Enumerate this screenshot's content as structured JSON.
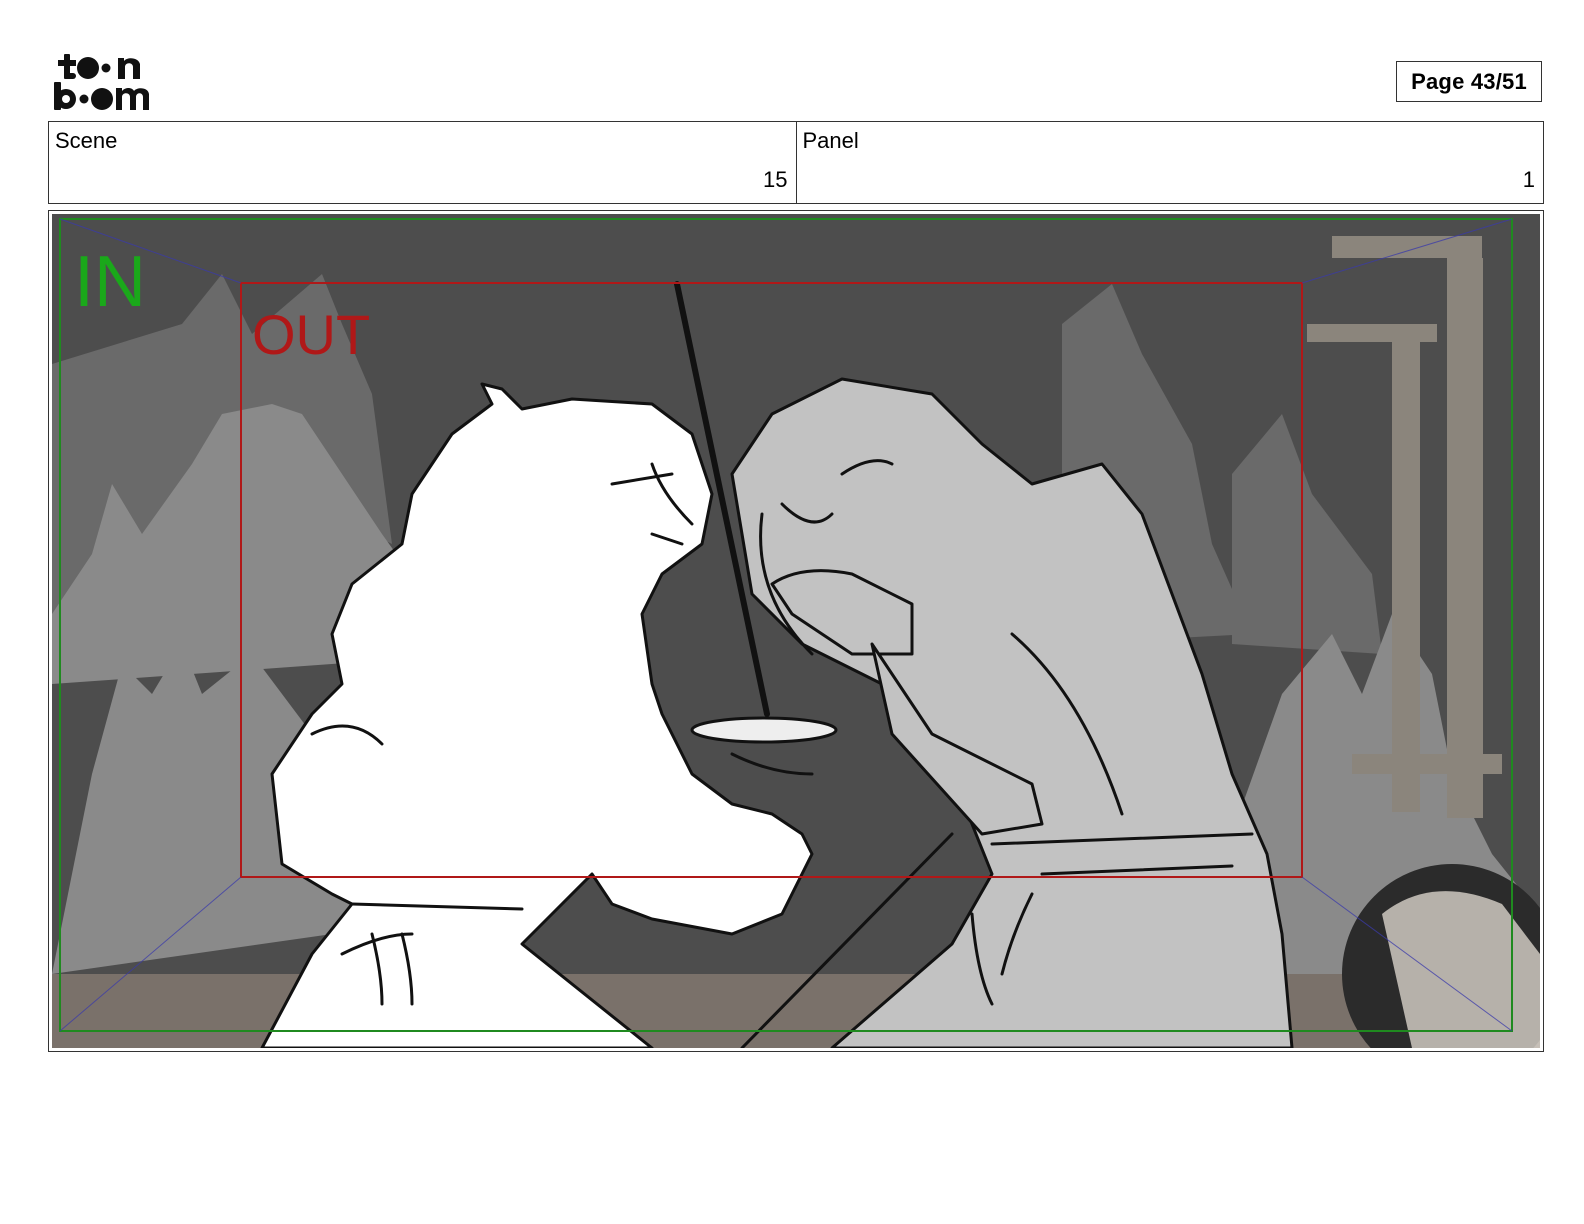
{
  "header": {
    "logo_line1": "toon",
    "logo_line2": "boom",
    "page_label": "Page 43/51"
  },
  "scene": {
    "label": "Scene",
    "value": "15"
  },
  "panel": {
    "label": "Panel",
    "value": "1"
  },
  "artwork": {
    "in_label": "IN",
    "out_label": "OUT",
    "colors": {
      "in_frame": "#1f8a1f",
      "in_text": "#1aa81a",
      "out_frame": "#b01818",
      "out_text": "#b01818",
      "diagonals": "#3a3aaa",
      "sky": "#4d4d4d",
      "far_trees": "#6a6a6a",
      "near_trees": "#8a8a8a",
      "ground": "#7a716a",
      "girl_fill": "#ffffff",
      "man_fill": "#c2c2c2",
      "line_art": "#111111"
    }
  }
}
